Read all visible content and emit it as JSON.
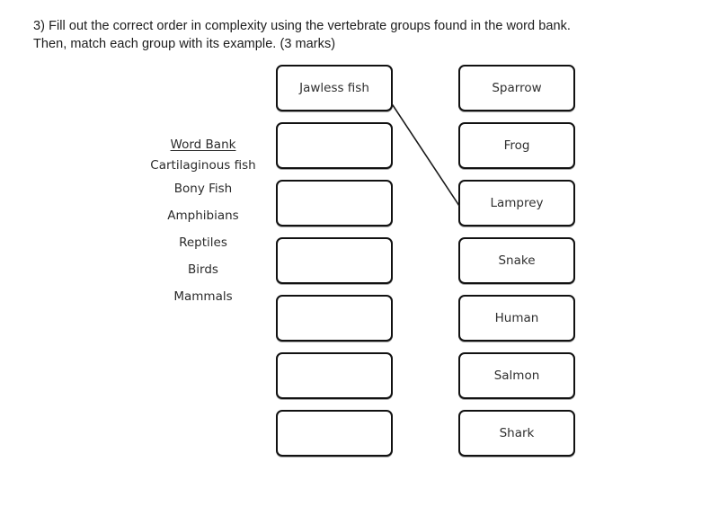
{
  "question": {
    "line1": "3) Fill out the correct order in complexity using the vertebrate groups found in the word bank.",
    "line2": "Then, match each group with its example. (3 marks)"
  },
  "word_bank": {
    "title": "Word Bank",
    "items": [
      "Cartilaginous fish",
      "Bony Fish",
      "Amphibians",
      "Reptiles",
      "Birds",
      "Mammals"
    ]
  },
  "left_column": {
    "boxes": [
      "Jawless fish",
      "",
      "",
      "",
      "",
      "",
      ""
    ]
  },
  "right_column": {
    "boxes": [
      "Sparrow",
      "Frog",
      "Lamprey",
      "Snake",
      "Human",
      "Salmon",
      "Shark"
    ]
  },
  "connections": [
    {
      "from": "Jawless fish",
      "to": "Lamprey"
    }
  ],
  "colors": {
    "border": "#111111",
    "text": "#2f2f2f",
    "background": "#ffffff",
    "connector": "#1a1a1a"
  }
}
